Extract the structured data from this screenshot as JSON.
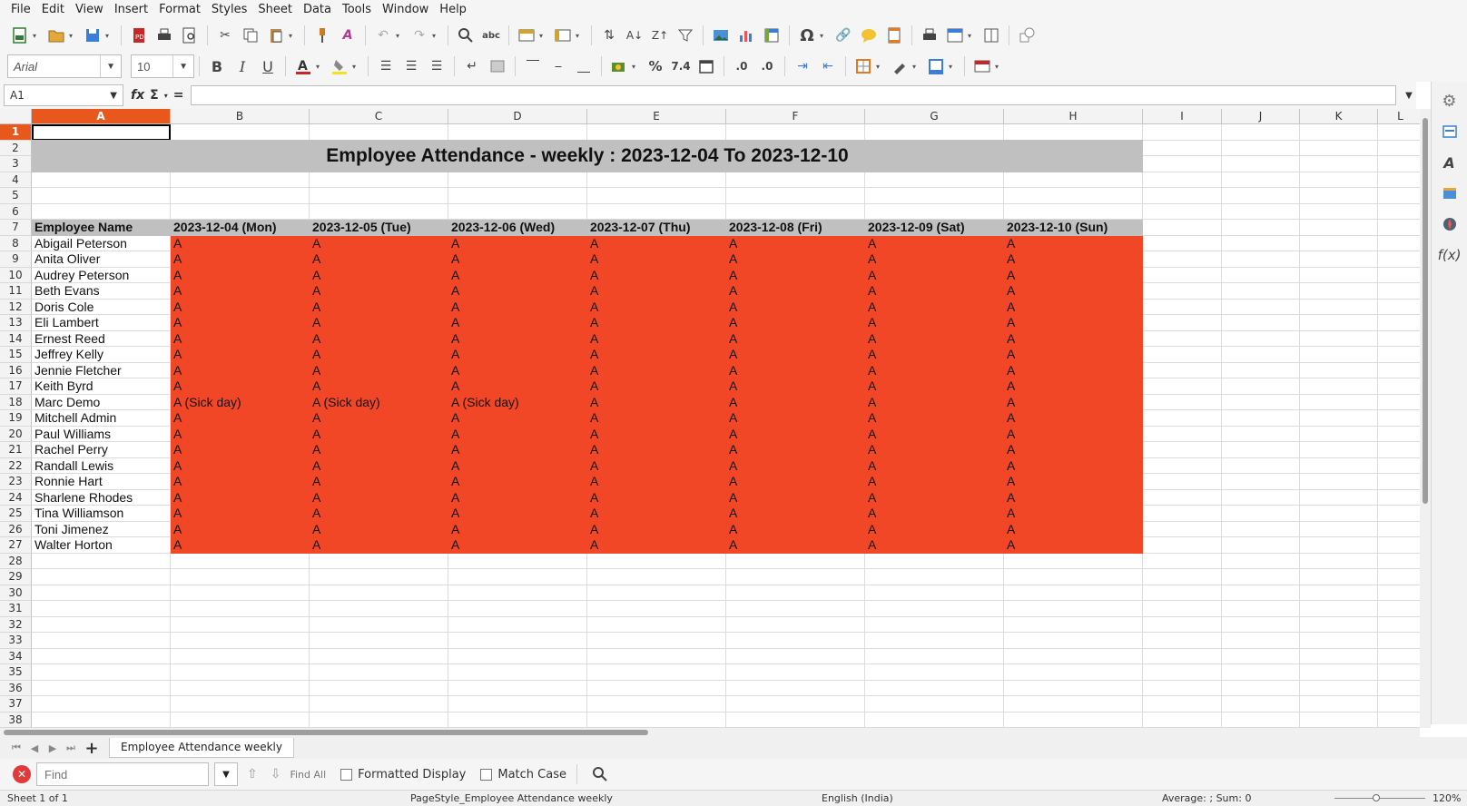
{
  "menu": [
    "File",
    "Edit",
    "View",
    "Insert",
    "Format",
    "Styles",
    "Sheet",
    "Data",
    "Tools",
    "Window",
    "Help"
  ],
  "font": {
    "name": "Arial",
    "size": "10"
  },
  "namebox": "A1",
  "formula_value": "",
  "columns": [
    "A",
    "B",
    "C",
    "D",
    "E",
    "F",
    "G",
    "H",
    "I",
    "J",
    "K",
    "L"
  ],
  "title": "Employee Attendance - weekly : 2023-12-04 To 2023-12-10",
  "header": {
    "name": "Employee Name",
    "days": [
      "2023-12-04 (Mon)",
      "2023-12-05 (Tue)",
      "2023-12-06 (Wed)",
      "2023-12-07 (Thu)",
      "2023-12-08 (Fri)",
      "2023-12-09 (Sat)",
      "2023-12-10 (Sun)"
    ]
  },
  "employees": [
    {
      "name": "Abigail Peterson",
      "days": [
        "A",
        "A",
        "A",
        "A",
        "A",
        "A",
        "A"
      ]
    },
    {
      "name": "Anita Oliver",
      "days": [
        "A",
        "A",
        "A",
        "A",
        "A",
        "A",
        "A"
      ]
    },
    {
      "name": "Audrey Peterson",
      "days": [
        "A",
        "A",
        "A",
        "A",
        "A",
        "A",
        "A"
      ]
    },
    {
      "name": "Beth Evans",
      "days": [
        "A",
        "A",
        "A",
        "A",
        "A",
        "A",
        "A"
      ]
    },
    {
      "name": "Doris Cole",
      "days": [
        "A",
        "A",
        "A",
        "A",
        "A",
        "A",
        "A"
      ]
    },
    {
      "name": "Eli Lambert",
      "days": [
        "A",
        "A",
        "A",
        "A",
        "A",
        "A",
        "A"
      ]
    },
    {
      "name": "Ernest Reed",
      "days": [
        "A",
        "A",
        "A",
        "A",
        "A",
        "A",
        "A"
      ]
    },
    {
      "name": "Jeffrey Kelly",
      "days": [
        "A",
        "A",
        "A",
        "A",
        "A",
        "A",
        "A"
      ]
    },
    {
      "name": "Jennie Fletcher",
      "days": [
        "A",
        "A",
        "A",
        "A",
        "A",
        "A",
        "A"
      ]
    },
    {
      "name": "Keith Byrd",
      "days": [
        "A",
        "A",
        "A",
        "A",
        "A",
        "A",
        "A"
      ]
    },
    {
      "name": "Marc Demo",
      "days": [
        "A (Sick day)",
        "A (Sick day)",
        "A (Sick day)",
        "A",
        "A",
        "A",
        "A"
      ]
    },
    {
      "name": "Mitchell Admin",
      "days": [
        "A",
        "A",
        "A",
        "A",
        "A",
        "A",
        "A"
      ]
    },
    {
      "name": "Paul Williams",
      "days": [
        "A",
        "A",
        "A",
        "A",
        "A",
        "A",
        "A"
      ]
    },
    {
      "name": "Rachel Perry",
      "days": [
        "A",
        "A",
        "A",
        "A",
        "A",
        "A",
        "A"
      ]
    },
    {
      "name": "Randall Lewis",
      "days": [
        "A",
        "A",
        "A",
        "A",
        "A",
        "A",
        "A"
      ]
    },
    {
      "name": "Ronnie Hart",
      "days": [
        "A",
        "A",
        "A",
        "A",
        "A",
        "A",
        "A"
      ]
    },
    {
      "name": "Sharlene Rhodes",
      "days": [
        "A",
        "A",
        "A",
        "A",
        "A",
        "A",
        "A"
      ]
    },
    {
      "name": "Tina Williamson",
      "days": [
        "A",
        "A",
        "A",
        "A",
        "A",
        "A",
        "A"
      ]
    },
    {
      "name": "Toni Jimenez",
      "days": [
        "A",
        "A",
        "A",
        "A",
        "A",
        "A",
        "A"
      ]
    },
    {
      "name": "Walter Horton",
      "days": [
        "A",
        "A",
        "A",
        "A",
        "A",
        "A",
        "A"
      ]
    }
  ],
  "sheet_tab": "Employee Attendance weekly",
  "find": {
    "placeholder": "Find",
    "find_all": "Find All",
    "formatted_display": "Formatted Display",
    "match_case": "Match Case"
  },
  "status": {
    "sheet": "Sheet 1 of 1",
    "page_style": "PageStyle_Employee Attendance weekly",
    "language": "English (India)",
    "sum": "Average: ; Sum: 0",
    "zoom": "120%"
  },
  "colors": {
    "absent": "#f24726",
    "header": "#c0c0c0",
    "selection": "#e8581c"
  }
}
